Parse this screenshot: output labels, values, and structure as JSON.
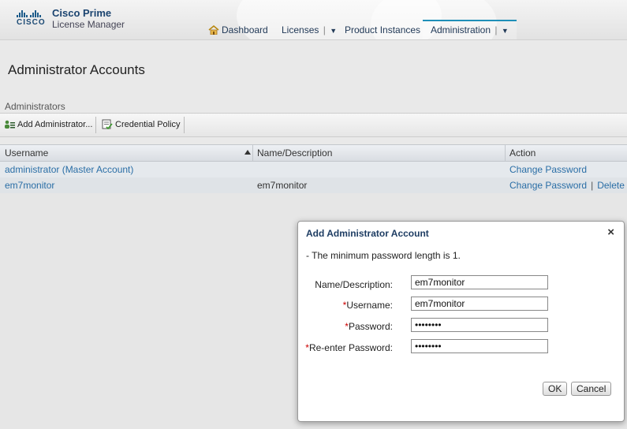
{
  "header": {
    "brand_word": "CISCO",
    "product_name": "Cisco Prime",
    "product_sub": "License Manager",
    "nav": [
      {
        "label": "Dashboard"
      },
      {
        "label": "Licenses",
        "arrow": "▼"
      },
      {
        "label": "Product Instances"
      },
      {
        "label": "Administration",
        "arrow": "▼"
      }
    ]
  },
  "page": {
    "title": "Administrator Accounts",
    "section": "Administrators"
  },
  "toolbar": {
    "add_label": "Add Administrator...",
    "policy_label": "Credential Policy"
  },
  "table": {
    "columns": [
      "Username",
      "Name/Description",
      "Action"
    ],
    "rows": [
      {
        "username": "administrator (Master Account)",
        "description": "",
        "action1": "Change Password",
        "action2": ""
      },
      {
        "username": "em7monitor",
        "description": "em7monitor",
        "action1": "Change Password",
        "action2": "Delete"
      }
    ]
  },
  "dialog": {
    "title": "Add Administrator Account",
    "close": "×",
    "note": "- The minimum password length is 1.",
    "fields": [
      {
        "label": "Name/Description:",
        "required": "",
        "value": "em7monitor"
      },
      {
        "label": "Username:",
        "required": "*",
        "value": "em7monitor"
      },
      {
        "label": "Password:",
        "required": "*",
        "value": "••••••••"
      },
      {
        "label": "Re-enter Password:",
        "required": "*",
        "value": "••••••••"
      }
    ],
    "ok_label": "OK",
    "cancel_label": "Cancel"
  },
  "colors": {
    "link": "#2a6ea6",
    "accent": "#1f8fb8",
    "required": "#cc0000"
  }
}
